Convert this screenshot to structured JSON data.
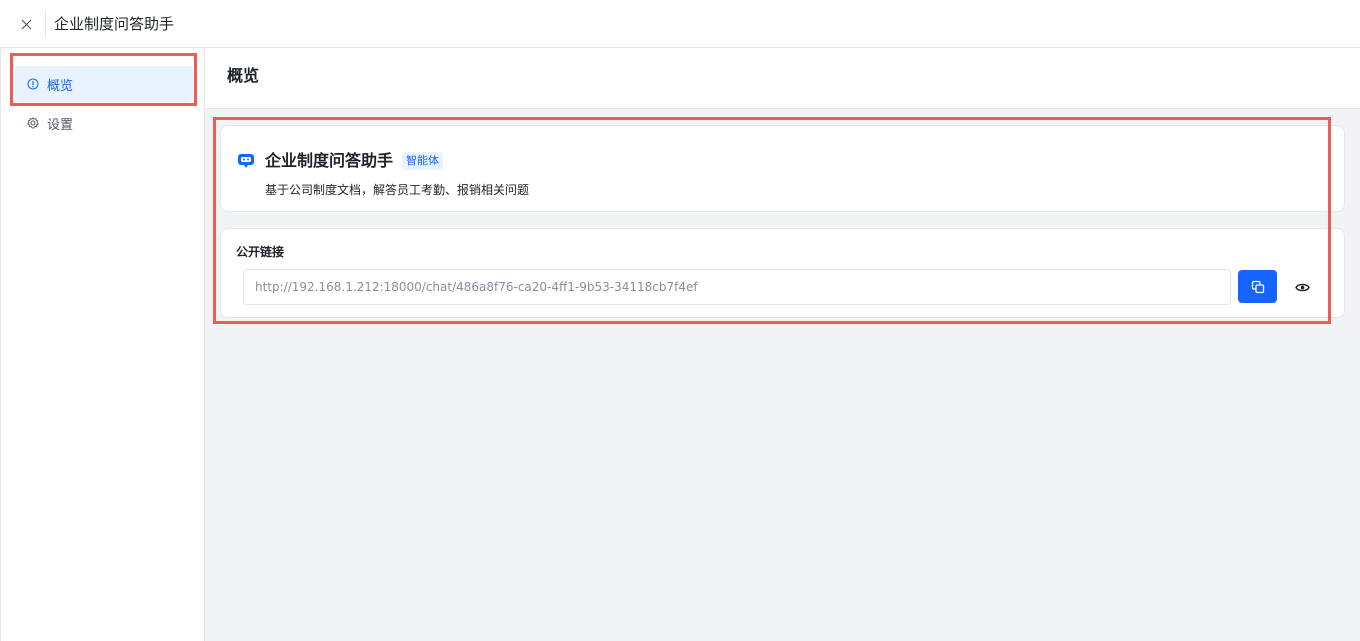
{
  "window": {
    "title": "企业制度问答助手"
  },
  "sidebar": {
    "items": [
      {
        "label": "概览",
        "icon": "info-circle-icon",
        "active": true
      },
      {
        "label": "设置",
        "icon": "gear-icon",
        "active": false
      }
    ]
  },
  "main": {
    "title": "概览",
    "bot": {
      "name": "企业制度问答助手",
      "tag": "智能体",
      "description": "基于公司制度文档，解答员工考勤、报销相关问题",
      "icon": "chat-bot-icon"
    },
    "public_link": {
      "label": "公开链接",
      "url": "http://192.168.1.212:18000/chat/486a8f76-ca20-4ff1-9b53-34118cb7f4ef"
    }
  },
  "colors": {
    "accent": "#1664ff",
    "accent_light": "#e8f3ff",
    "highlight": "#ee5b5b",
    "background": "#f2f3f5"
  }
}
